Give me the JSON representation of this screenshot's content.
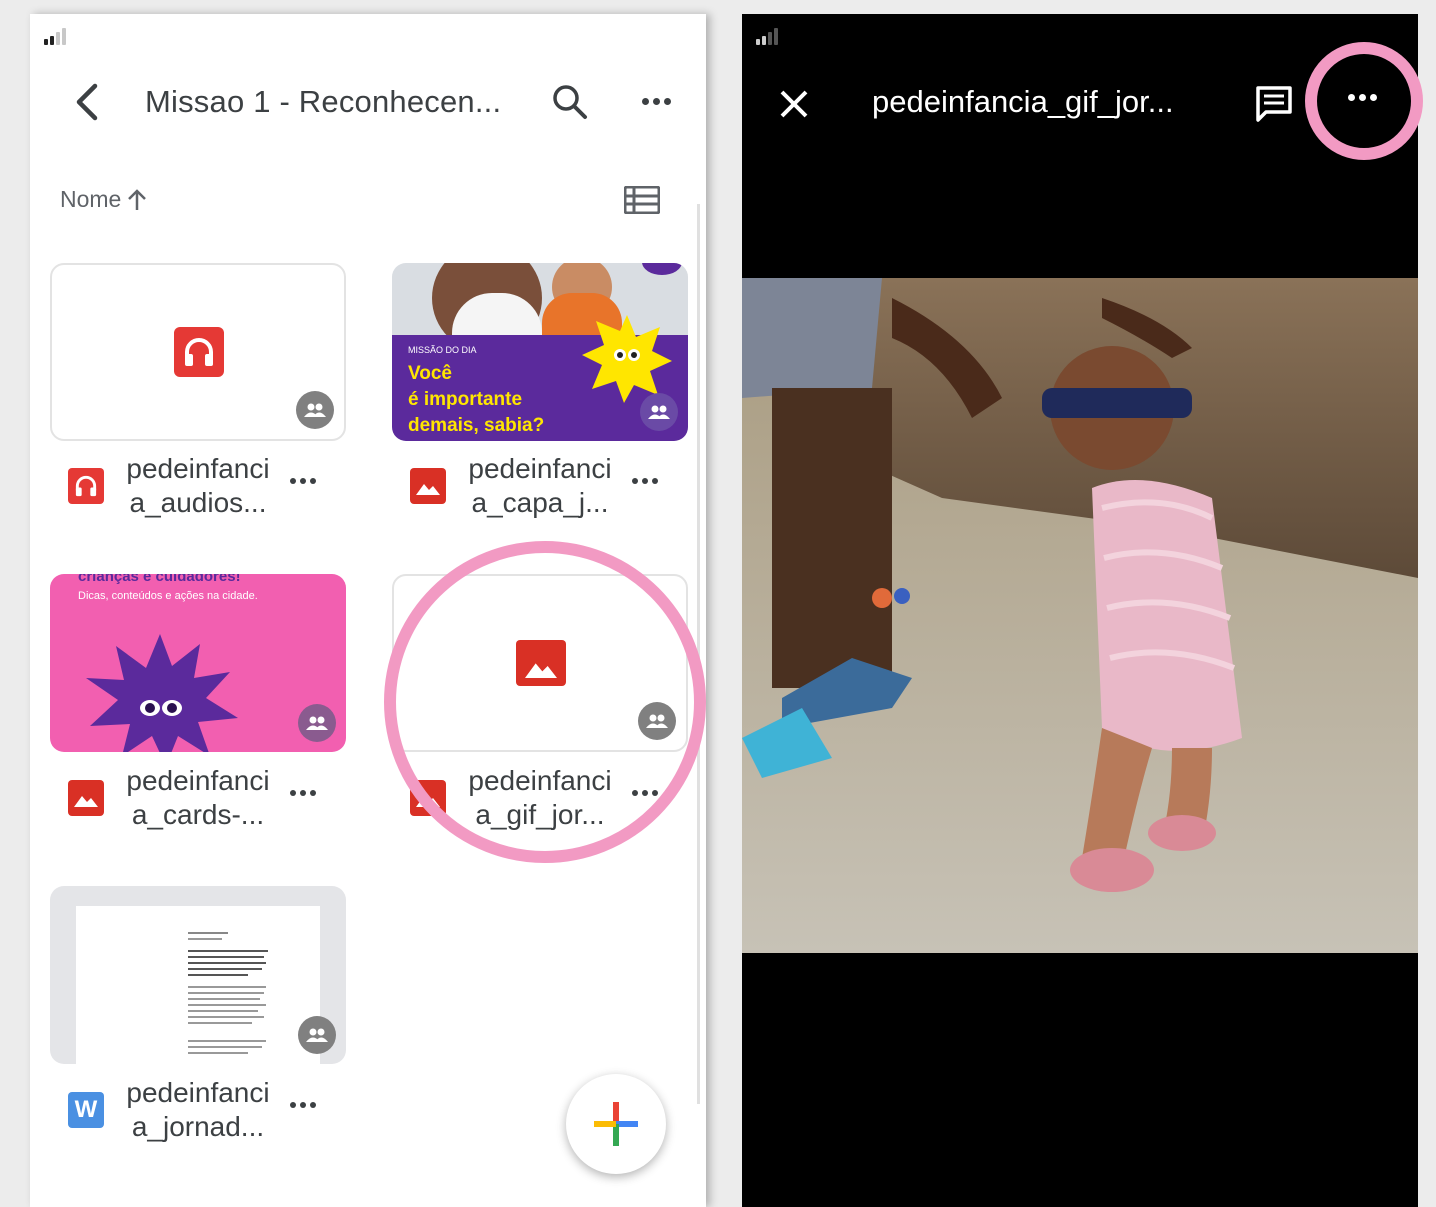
{
  "left_screen": {
    "header": {
      "folder_title": "Missao 1 - Reconhecen...",
      "back_icon": "chevron-left-icon",
      "search_icon": "search-icon",
      "more_icon": "more-horizontal-icon"
    },
    "sort": {
      "label": "Nome",
      "direction_icon": "arrow-up-icon",
      "view_toggle_icon": "list-view-icon"
    },
    "files": [
      {
        "name": "pedeinfanci\na_audios...",
        "type": "audio",
        "type_color": "#e53935",
        "shared": true
      },
      {
        "name": "pedeinfanci\na_capa_j...",
        "type": "image",
        "type_color": "#d93025",
        "shared": true,
        "thumb": {
          "kicker": "MISSÃO DO DIA",
          "line1": "Você",
          "line2": "é importante",
          "line3": "demais, sabia?"
        }
      },
      {
        "name": "pedeinfanci\na_cards-...",
        "type": "image",
        "type_color": "#d93025",
        "shared": true,
        "thumb": {
          "heading": "crianças e cuidadores!",
          "subheading": "Dicas, conteúdos e ações na cidade."
        }
      },
      {
        "name": "pedeinfanci\na_gif_jor...",
        "type": "image",
        "type_color": "#d93025",
        "shared": true
      },
      {
        "name": "pedeinfanci\na_jornad...",
        "type": "word",
        "type_letter": "W",
        "type_color": "#4a90e2",
        "shared": true
      }
    ],
    "fab_icon": "plus-icon",
    "highlight_color": "#f29ac3"
  },
  "right_screen": {
    "header": {
      "title": "pedeinfancia_gif_jor...",
      "close_icon": "close-icon",
      "comment_icon": "comment-icon",
      "more_icon": "more-horizontal-icon"
    }
  }
}
